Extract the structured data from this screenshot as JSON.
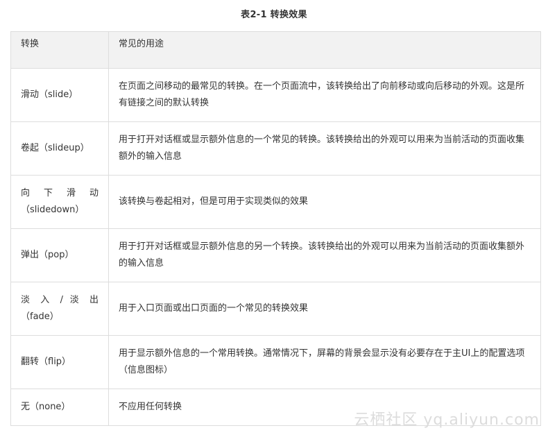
{
  "caption": "表2-1 转换效果",
  "table": {
    "headers": [
      "转换",
      "常见的用途"
    ],
    "rows": [
      {
        "name": "滑动（slide）",
        "desc": "在页面之间移动的最常见的转换。在一个页面流中，该转换给出了向前移动或向后移动的外观。这是所有链接之间的默认转换"
      },
      {
        "name": "卷起（slideup）",
        "desc": "用于打开对话框或显示额外信息的一个常见的转换。该转换给出的外观可以用来为当前活动的页面收集额外的输入信息"
      },
      {
        "name_line1": "向 下 滑 动",
        "name_line2": "（slidedown）",
        "desc": "该转换与卷起相对，但是可用于实现类似的效果"
      },
      {
        "name": "弹出（pop）",
        "desc": "用于打开对话框或显示额外信息的另一个转换。该转换给出的外观可以用来为当前活动的页面收集额外的输入信息"
      },
      {
        "name_line1": "淡 入 / 淡 出",
        "name_line2": "（fade）",
        "desc": "用于入口页面或出口页面的一个常见的转换效果"
      },
      {
        "name": "翻转（flip）",
        "desc": "用于显示额外信息的一个常用转换。通常情况下，屏幕的背景会显示没有必要存在于主UI上的配置选项（信息图标）"
      },
      {
        "name": "无（none）",
        "desc": "不应用任何转换"
      }
    ]
  },
  "watermark": "云栖社区 yq.aliyun.com"
}
